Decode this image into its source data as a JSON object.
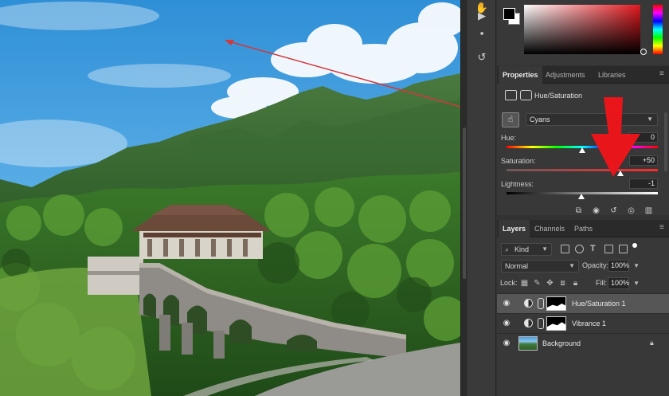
{
  "properties_tabs": [
    {
      "label": "Properties",
      "active": true
    },
    {
      "label": "Adjustments",
      "active": false
    },
    {
      "label": "Libraries",
      "active": false
    }
  ],
  "properties": {
    "title": "Hue/Saturation",
    "channel": "Cyans",
    "sliders": [
      {
        "label": "Hue:",
        "value": "0",
        "position": 0.5
      },
      {
        "label": "Saturation:",
        "value": "+50",
        "position": 0.75
      },
      {
        "label": "Lightness:",
        "value": "-1",
        "position": 0.495
      }
    ]
  },
  "layers_tabs": [
    {
      "label": "Layers",
      "active": true
    },
    {
      "label": "Channels",
      "active": false
    },
    {
      "label": "Paths",
      "active": false
    }
  ],
  "layers": {
    "kind_label": "Kind",
    "blend_mode": "Normal",
    "opacity_label": "Opacity:",
    "opacity_value": "100%",
    "lock_label": "Lock:",
    "fill_label": "Fill:",
    "fill_value": "100%",
    "items": [
      {
        "name": "Hue/Saturation 1",
        "selected": true
      },
      {
        "name": "Vibrance 1",
        "selected": false
      },
      {
        "name": "Background",
        "selected": false
      }
    ]
  },
  "colors": {
    "foreground": "#000000",
    "background": "#ffffff",
    "picker_hue": "#e3171e",
    "annotation_arrow": "#e8151b",
    "pointer_line": "#d2383c"
  },
  "icons": {
    "tools": [
      "hand-icon",
      "play-icon",
      "comment-icon",
      "history-icon"
    ],
    "props_footer": [
      "clip-icon",
      "view-previous-icon",
      "reset-icon",
      "visibility-icon",
      "trash-icon"
    ]
  }
}
